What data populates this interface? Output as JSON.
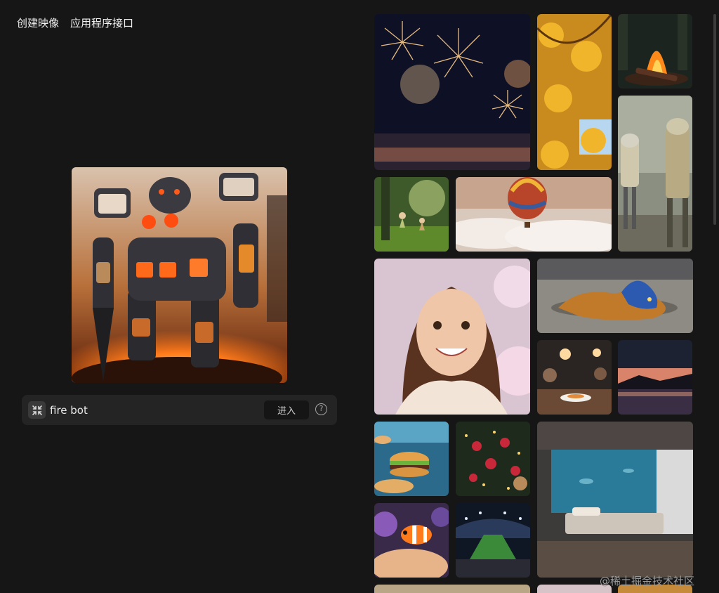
{
  "nav": {
    "create_label": "创建映像",
    "api_label": "应用程序接口"
  },
  "prompt": {
    "value": "fire bot",
    "enter_label": "进入",
    "help_glyph": "?"
  },
  "gallery": {
    "tiles": [
      {
        "name": "fireworks"
      },
      {
        "name": "autumn-leaves"
      },
      {
        "name": "campfire"
      },
      {
        "name": "droid-robots"
      },
      {
        "name": "fairies-forest"
      },
      {
        "name": "hot-air-balloon"
      },
      {
        "name": "smiling-girl"
      },
      {
        "name": "blue-dragon"
      },
      {
        "name": "restaurant"
      },
      {
        "name": "sunset-lake"
      },
      {
        "name": "burgers-sea"
      },
      {
        "name": "christmas-tree"
      },
      {
        "name": "underwater-bedroom"
      },
      {
        "name": "clownfish"
      },
      {
        "name": "football-stadium"
      }
    ]
  },
  "watermark": "@稀土掘金技术社区"
}
